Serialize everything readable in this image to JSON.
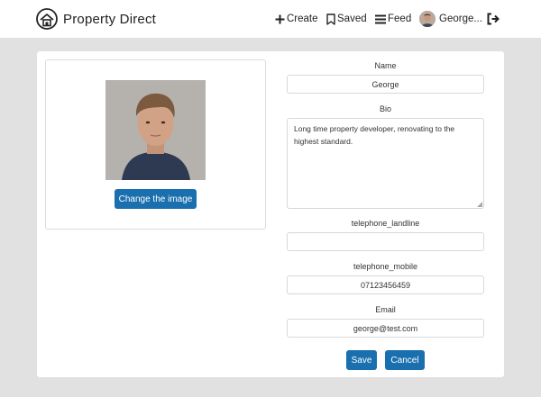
{
  "header": {
    "brand_name": "Property Direct",
    "nav": {
      "create": "Create",
      "saved": "Saved",
      "feed": "Feed",
      "user": "George..."
    }
  },
  "profile": {
    "change_image_label": "Change the image",
    "fields": {
      "name_label": "Name",
      "name_value": "George",
      "bio_label": "Bio",
      "bio_value": "Long time property developer, renovating to the highest standard.",
      "landline_label": "telephone_landline",
      "landline_value": "",
      "mobile_label": "telephone_mobile",
      "mobile_value": "07123456459",
      "email_label": "Email",
      "email_value": "george@test.com"
    },
    "save_label": "Save",
    "cancel_label": "Cancel"
  },
  "colors": {
    "primary_button": "#1a6fae",
    "page_background": "#e1e1e1",
    "card_background": "#ffffff"
  },
  "icons": [
    "home-logo-icon",
    "plus-icon",
    "bookmark-icon",
    "menu-icon",
    "logout-icon"
  ]
}
